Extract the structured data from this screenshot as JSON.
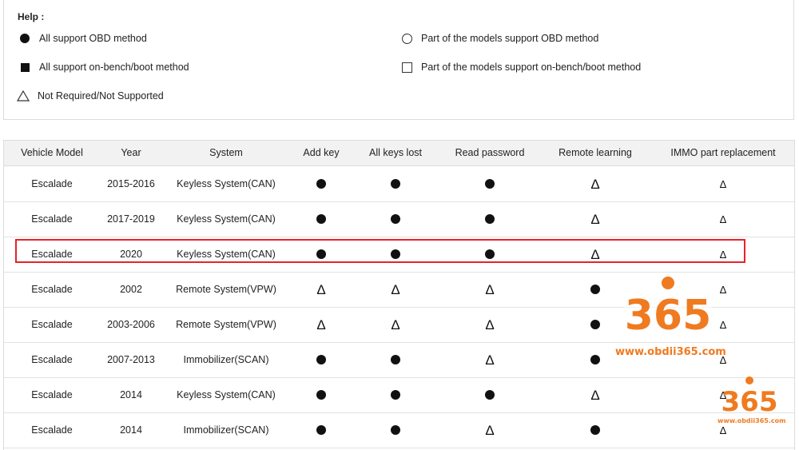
{
  "help": {
    "title": "Help :",
    "legend": [
      {
        "symbol": "filled-circle",
        "label": "All support OBD method"
      },
      {
        "symbol": "hollow-circle",
        "label": "Part of the models support OBD method"
      },
      {
        "symbol": "filled-square",
        "label": "All support on-bench/boot method"
      },
      {
        "symbol": "hollow-square",
        "label": "Part of the models support on-bench/boot method"
      },
      {
        "symbol": "triangle",
        "label": "Not Required/Not Supported"
      }
    ]
  },
  "table": {
    "headers": [
      "Vehicle Model",
      "Year",
      "System",
      "Add key",
      "All keys lost",
      "Read password",
      "Remote learning",
      "IMMO part replacement"
    ],
    "rows": [
      {
        "model": "Escalade",
        "year": "2015-2016",
        "system": "Keyless System(CAN)",
        "marks": [
          "dot",
          "dot",
          "dot",
          "tri",
          "tri-small"
        ]
      },
      {
        "model": "Escalade",
        "year": "2017-2019",
        "system": "Keyless System(CAN)",
        "marks": [
          "dot",
          "dot",
          "dot",
          "tri",
          "tri-small"
        ]
      },
      {
        "model": "Escalade",
        "year": "2020",
        "system": "Keyless System(CAN)",
        "marks": [
          "dot",
          "dot",
          "dot",
          "tri",
          "tri-small"
        ],
        "highlighted": true
      },
      {
        "model": "Escalade",
        "year": "2002",
        "system": "Remote System(VPW)",
        "marks": [
          "tri",
          "tri",
          "tri",
          "dot",
          "tri-small"
        ]
      },
      {
        "model": "Escalade",
        "year": "2003-2006",
        "system": "Remote System(VPW)",
        "marks": [
          "tri",
          "tri",
          "tri",
          "dot",
          "tri-small"
        ]
      },
      {
        "model": "Escalade",
        "year": "2007-2013",
        "system": "Immobilizer(SCAN)",
        "marks": [
          "dot",
          "dot",
          "tri",
          "dot",
          "tri-small"
        ]
      },
      {
        "model": "Escalade",
        "year": "2014",
        "system": "Keyless System(CAN)",
        "marks": [
          "dot",
          "dot",
          "dot",
          "tri",
          "tri-small"
        ]
      },
      {
        "model": "Escalade",
        "year": "2014",
        "system": "Immobilizer(SCAN)",
        "marks": [
          "dot",
          "dot",
          "tri",
          "dot",
          "tri-small"
        ]
      }
    ]
  },
  "symbols": {
    "triangle": "Δ"
  },
  "watermark": {
    "large_logo": "365",
    "large_url": "www.obdii365.com",
    "small_logo": "365",
    "small_url": "www.obdii365.com",
    "color": "#f07a20"
  },
  "highlight_color": "#e3242b"
}
